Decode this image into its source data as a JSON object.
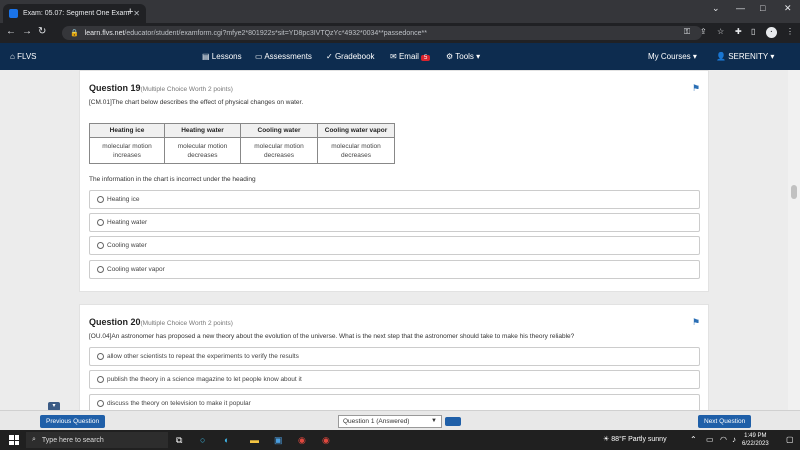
{
  "browser": {
    "tab_title": "Exam: 05.07: Segment One Exam",
    "url_host": "learn.flvs.net",
    "url_path": "/educator/student/examform.cgi?mfye2*801922s*sit=YD8pc3IVTQzYc*4932*0034**passedonce**"
  },
  "nav": {
    "brand": "FLVS",
    "lessons": "Lessons",
    "assessments": "Assessments",
    "gradebook": "Gradebook",
    "email": "Email",
    "email_count": "5",
    "tools": "Tools",
    "my_courses": "My Courses",
    "user": "SERENITY"
  },
  "q19": {
    "title": "Question 19",
    "worth": "(Multiple Choice Worth 2 points)",
    "prompt": "[CM.01]The chart below describes the effect of physical changes on water.",
    "table": {
      "headers": [
        "Heating ice",
        "Heating water",
        "Cooling water",
        "Cooling water vapor"
      ],
      "cells": [
        [
          "molecular motion",
          "molecular motion",
          "molecular motion",
          "molecular motion"
        ],
        [
          "increases",
          "decreases",
          "decreases",
          "decreases"
        ]
      ]
    },
    "stem": "The information in the chart is incorrect under the heading",
    "choices": [
      "Heating ice",
      "Heating water",
      "Cooling water",
      "Cooling water vapor"
    ]
  },
  "q20": {
    "title": "Question 20",
    "worth": "(Multiple Choice Worth 2 points)",
    "prompt": "[OU.04]An astronomer has proposed a new theory about the evolution of the universe. What is the next step that the astronomer should take to make his theory reliable?",
    "choices": [
      "allow other scientists to repeat the experiments to verify the results",
      "publish the theory in a science magazine to let people know about it",
      "discuss the theory on television to make it popular"
    ]
  },
  "footer": {
    "previous": "Previous Question",
    "select_value": "Question 1 (Answered)",
    "next": "Next Question"
  },
  "taskbar": {
    "search_placeholder": "Type here to search",
    "temperature": "88°F",
    "weather": "Partly sunny",
    "time": "1:49 PM",
    "date": "6/22/2023"
  }
}
